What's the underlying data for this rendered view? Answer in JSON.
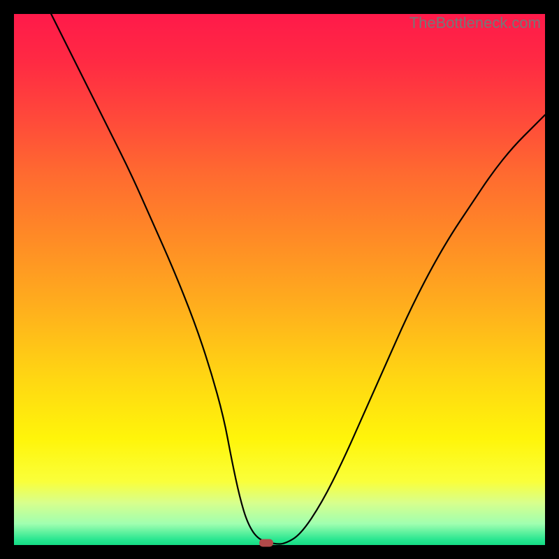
{
  "watermark": "TheBottleneck.com",
  "chart_data": {
    "type": "line",
    "title": "",
    "xlabel": "",
    "ylabel": "",
    "xlim": [
      0,
      100
    ],
    "ylim": [
      0,
      100
    ],
    "grid": false,
    "series": [
      {
        "name": "curve",
        "color": "#000000",
        "x": [
          7,
          10,
          14,
          18,
          22,
          26,
          30,
          34,
          37,
          39.5,
          41,
          42.5,
          44,
          46,
          49,
          51,
          54,
          58,
          62,
          66,
          70,
          74,
          78,
          82,
          86,
          90,
          94,
          98,
          100
        ],
        "y": [
          100,
          94,
          86,
          78,
          70,
          61,
          52,
          42,
          33,
          24,
          16,
          9,
          4,
          1,
          0.2,
          0.2,
          2,
          8,
          16,
          25,
          34,
          43,
          51,
          58,
          64,
          70,
          75,
          79,
          81
        ]
      }
    ],
    "flat_segment": {
      "x_start": 44,
      "x_end": 51,
      "y": 0.4
    },
    "marker": {
      "x": 47.5,
      "y": 0.4,
      "color": "#b24a4a"
    },
    "gradient_stops": [
      {
        "pos": 0,
        "color": "#ff1a4a"
      },
      {
        "pos": 20,
        "color": "#ff4a3a"
      },
      {
        "pos": 42,
        "color": "#ff8a26"
      },
      {
        "pos": 68,
        "color": "#ffd513"
      },
      {
        "pos": 88,
        "color": "#faff3a"
      },
      {
        "pos": 96,
        "color": "#a0ffb0"
      },
      {
        "pos": 100,
        "color": "#14db84"
      }
    ]
  }
}
